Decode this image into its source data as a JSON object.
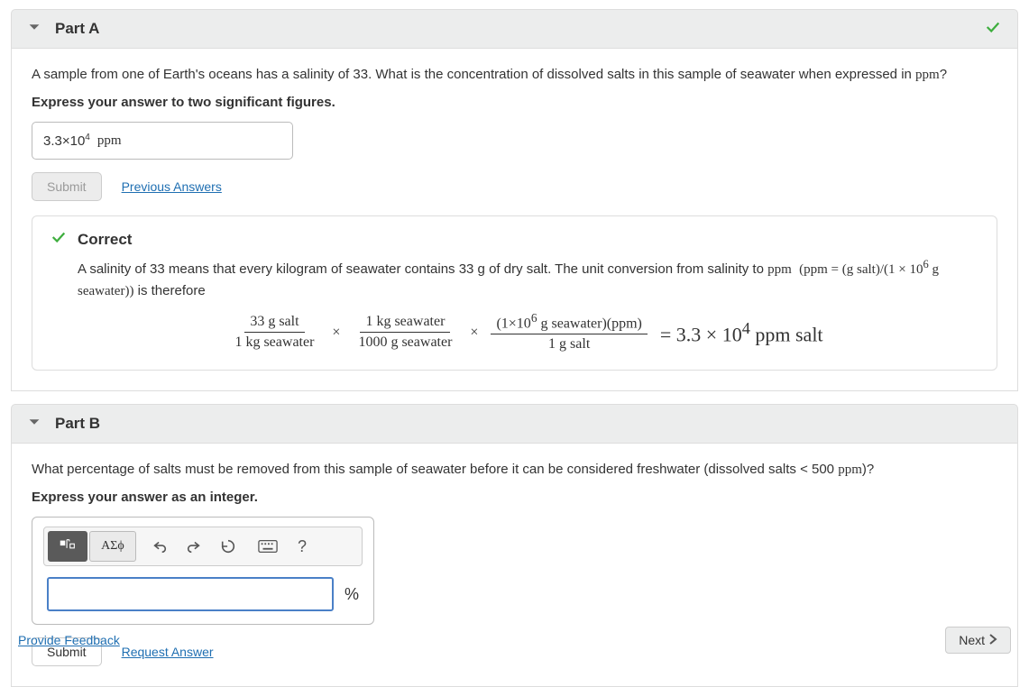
{
  "partA": {
    "title": "Part A",
    "prompt_pre": "A sample from one of Earth's oceans has a salinity of 33. What is the concentration of dissolved salts in this sample of seawater when expressed in ",
    "prompt_unit": "ppm",
    "prompt_post": "?",
    "instruction": "Express your answer to two significant figures.",
    "answer_value_html": "3.3×10<sup>4</sup>",
    "answer_unit": "ppm",
    "submit_label": "Submit",
    "previous_answers": "Previous Answers"
  },
  "feedbackA": {
    "heading": "Correct",
    "text_pre": "A salinity of 33 means that every kilogram of seawater contains 33 g of dry salt. The unit conversion from salinity to ",
    "ppm": "ppm",
    "relation_html": "(ppm = (g salt)/(1 × 10<sup>6</sup> g seawater))",
    "text_post": " is therefore",
    "frac1_num": "33 g salt",
    "frac1_den": "1 kg seawater",
    "frac2_num": "1 kg seawater",
    "frac2_den": "1000 g seawater",
    "frac3_num_html": "(1×10<sup>6</sup> g seawater)(ppm)",
    "frac3_den": "1 g salt",
    "result_html": "= 3.3 × 10<sup>4</sup> ppm salt",
    "times": "×"
  },
  "partB": {
    "title": "Part B",
    "prompt_pre": "What percentage of salts must be removed from this sample of seawater before it can be considered freshwater (dissolved salts < 500 ",
    "prompt_unit": "ppm",
    "prompt_post": ")?",
    "instruction": "Express your answer as an integer.",
    "greek_label": "ΑΣϕ",
    "percent": "%",
    "submit_label": "Submit",
    "request_answer": "Request Answer"
  },
  "footer": {
    "provide_feedback": "Provide Feedback",
    "next": "Next"
  },
  "icons": {
    "caret_down": "caret-down-icon",
    "check": "check-icon",
    "undo": "undo-icon",
    "redo": "redo-icon",
    "reset": "reset-icon",
    "keyboard": "keyboard-icon",
    "help": "help-icon",
    "template": "template-icon",
    "chevron_right": "chevron-right-icon"
  }
}
